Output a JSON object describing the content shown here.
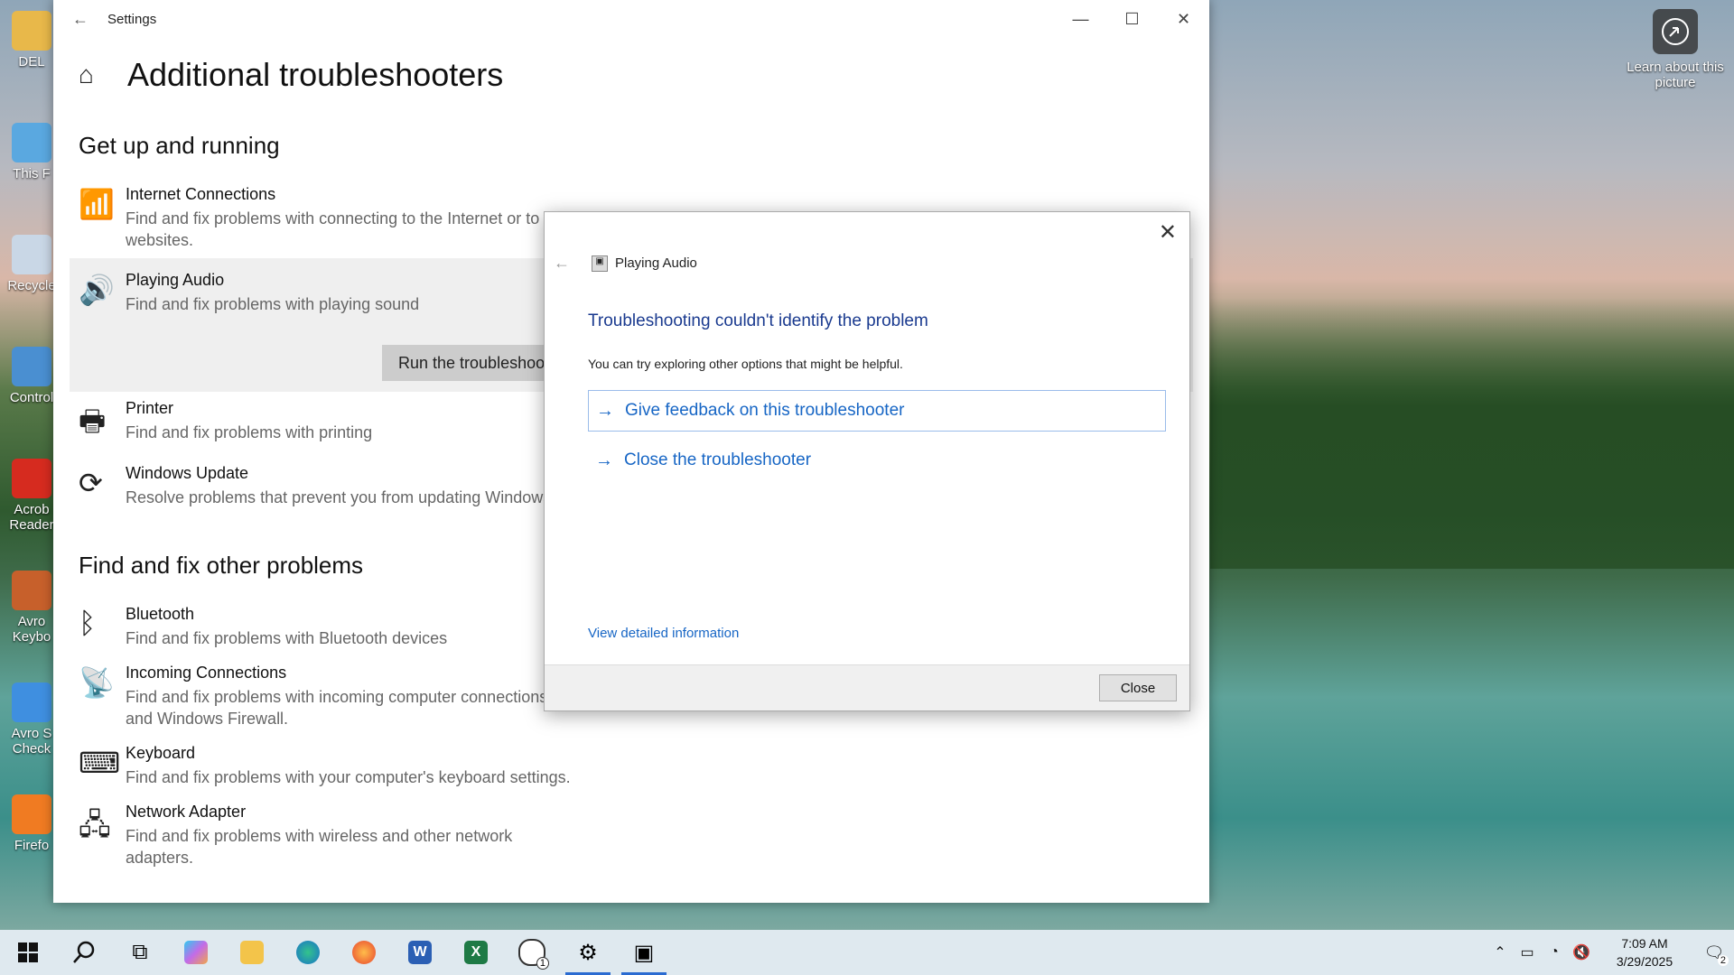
{
  "desktop": {
    "icons": [
      {
        "label": "DEL",
        "color": "#e8b84a"
      },
      {
        "label": "This F",
        "color": "#5aa8e0"
      },
      {
        "label": "Recycle",
        "color": "#c9d7e6"
      },
      {
        "label": "Control",
        "color": "#4a8fd1"
      },
      {
        "label": "Acrob Reader",
        "color": "#d62b1f"
      },
      {
        "label": "Avro Keybo",
        "color": "#c7602b"
      },
      {
        "label": "Avro S Check",
        "color": "#3f8fe0"
      },
      {
        "label": "Firefo",
        "color": "#f07b22"
      }
    ],
    "learn_label": "Learn about this picture"
  },
  "settings": {
    "window_title": "Settings",
    "page_title": "Additional troubleshooters",
    "section1": "Get up and running",
    "items1": [
      {
        "name": "Internet Connections",
        "desc": "Find and fix problems with connecting to the Internet or to websites.",
        "icon": "wifi-icon",
        "glyph": "📶"
      },
      {
        "name": "Playing Audio",
        "desc": "Find and fix problems with playing sound",
        "icon": "speaker-icon",
        "glyph": "🔊"
      },
      {
        "name": "Printer",
        "desc": "Find and fix problems with printing",
        "icon": "printer-icon",
        "glyph": "🖶"
      },
      {
        "name": "Windows Update",
        "desc": "Resolve problems that prevent you from updating Windows.",
        "icon": "update-icon",
        "glyph": "⟳"
      }
    ],
    "run_button": "Run the troubleshoot",
    "section2": "Find and fix other problems",
    "items2": [
      {
        "name": "Bluetooth",
        "desc": "Find and fix problems with Bluetooth devices",
        "icon": "bluetooth-icon",
        "glyph": "ᛒ"
      },
      {
        "name": "Incoming Connections",
        "desc": "Find and fix problems with incoming computer connections and Windows Firewall.",
        "icon": "antenna-icon",
        "glyph": "📡"
      },
      {
        "name": "Keyboard",
        "desc": "Find and fix problems with your computer's keyboard settings.",
        "icon": "keyboard-icon",
        "glyph": "⌨"
      },
      {
        "name": "Network Adapter",
        "desc": "Find and fix problems with wireless and other network adapters.",
        "icon": "network-icon",
        "glyph": "🖧"
      }
    ]
  },
  "dialog": {
    "title": "Playing Audio",
    "heading": "Troubleshooting couldn't identify the problem",
    "subtext": "You can try exploring other options that might be helpful.",
    "option1": "Give feedback on this troubleshooter",
    "option2": "Close the troubleshooter",
    "detail_link": "View detailed information",
    "close_button": "Close"
  },
  "taskbar": {
    "whatsapp_badge": "1",
    "time": "7:09 AM",
    "date": "3/29/2025",
    "notifications": "2"
  }
}
